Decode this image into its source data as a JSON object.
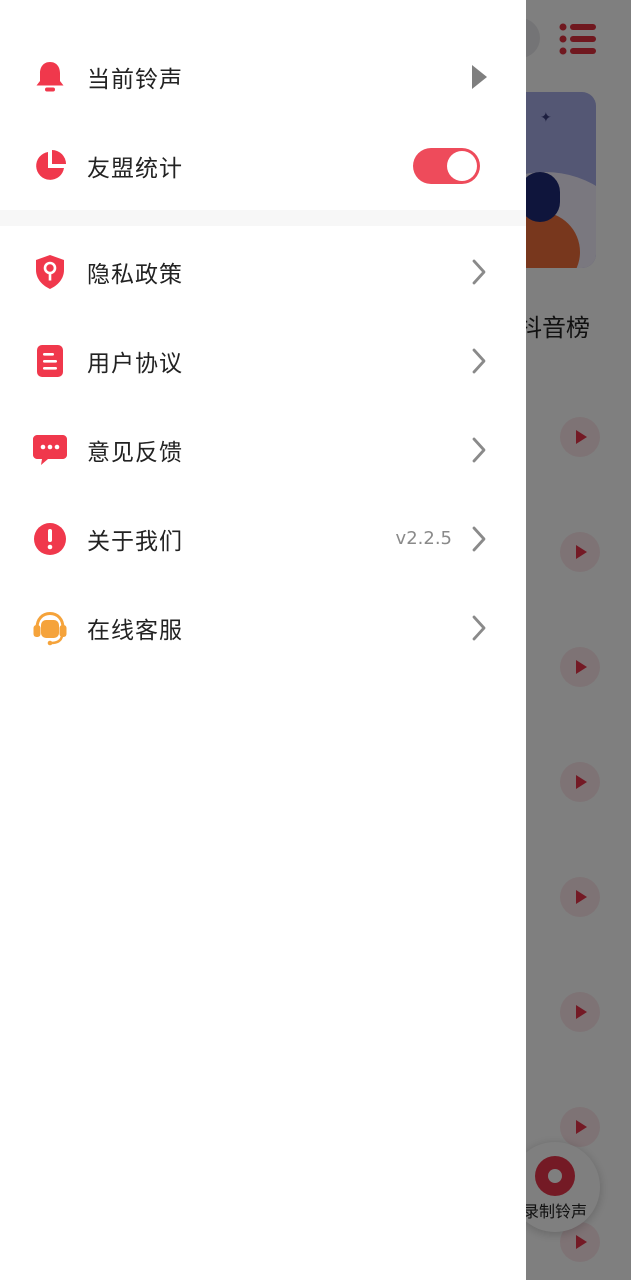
{
  "background": {
    "tab_label": "抖音榜",
    "record_button_label": "录制铃声"
  },
  "drawer": {
    "items": [
      {
        "label": "当前铃声",
        "icon": "bell-icon"
      },
      {
        "label": "友盟统计",
        "icon": "pie-chart-icon",
        "toggle_on": true
      },
      {
        "label": "隐私政策",
        "icon": "shield-key-icon"
      },
      {
        "label": "用户协议",
        "icon": "document-icon"
      },
      {
        "label": "意见反馈",
        "icon": "chat-bubble-icon"
      },
      {
        "label": "关于我们",
        "icon": "exclamation-icon",
        "value": "v2.2.5"
      },
      {
        "label": "在线客服",
        "icon": "headset-icon"
      }
    ]
  },
  "colors": {
    "accent": "#ee4b5b",
    "icon_red": "#f0384c",
    "headset_orange": "#f5a33b",
    "chevron": "#8a8a8a"
  }
}
